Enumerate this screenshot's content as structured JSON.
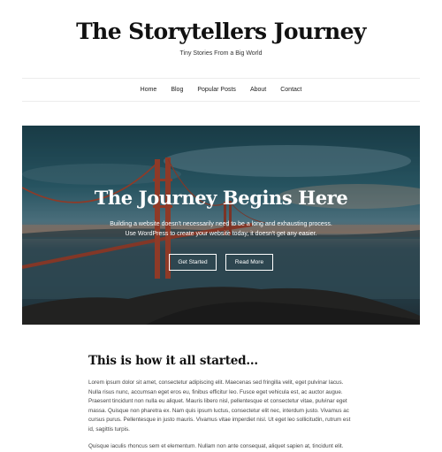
{
  "site": {
    "title": "The Storytellers Journey",
    "tagline": "Tiny Stories From a Big World"
  },
  "nav": {
    "items": [
      {
        "label": "Home"
      },
      {
        "label": "Blog"
      },
      {
        "label": "Popular Posts"
      },
      {
        "label": "About"
      },
      {
        "label": "Contact"
      }
    ]
  },
  "hero": {
    "title": "The Journey Begins Here",
    "text": "Building a website doesn't necessarily need to be a long and exhausting process. Use WordPress to create your website today, it doesn't get any easier.",
    "primary_button": "Get Started",
    "secondary_button": "Read More",
    "image_subject": "Golden Gate Bridge at sunset over the bay"
  },
  "post": {
    "title": "This is how it all started...",
    "paragraph1": "Lorem ipsum dolor sit amet, consectetur adipiscing elit. Maecenas sed fringilla velit, eget pulvinar lacus. Nulla risus nunc, accumsan eget eros eu, finibus efficitur leo. Fusce eget vehicula est, ac auctor augue. Praesent tincidunt non nulla eu aliquet. Mauris libero nisl, pellentesque et consectetur vitae, pulvinar eget massa. Quisque non pharetra ex. Nam quis ipsum luctus, consectetur elit nec, interdum justo. Vivamus ac cursus purus. Pellentesque in justo mauris. Vivamus vitae imperdiet nisl. Ut eget leo sollicitudin, rutrum est id, sagittis turpis.",
    "paragraph2": "Quisque iaculis rhoncus sem et elementum. Nullam non ante consequat, aliquet sapien at, tincidunt elit."
  },
  "colors": {
    "bridge": "#b5452a",
    "text": "#222222",
    "divider": "#ececec"
  }
}
